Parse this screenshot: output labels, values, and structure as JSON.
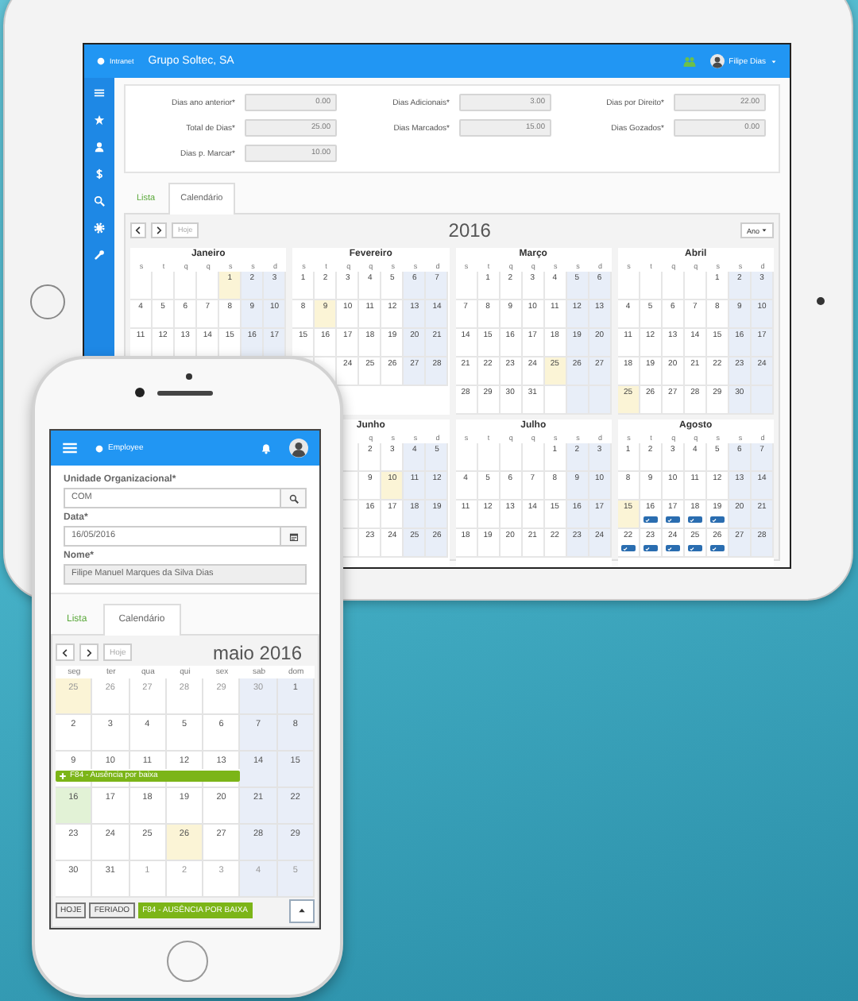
{
  "tablet": {
    "topbar": {
      "app": "Intranet",
      "company": "Grupo Soltec, SA",
      "user": "Filipe Dias"
    },
    "sidebar": {
      "items": [
        {
          "kind": "menu"
        },
        {
          "kind": "star"
        },
        {
          "kind": "user"
        },
        {
          "kind": "dollar"
        },
        {
          "kind": "search"
        },
        {
          "kind": "gear"
        },
        {
          "kind": "wrench"
        }
      ]
    },
    "fields": [
      {
        "label": "Dias ano anterior*",
        "value": "0.00",
        "disabled": true
      },
      {
        "label": "Dias Adicionais*",
        "value": "3.00",
        "disabled": true
      },
      {
        "label": "Dias por Direito*",
        "value": "22.00",
        "disabled": true
      },
      {
        "label": "Total de Dias*",
        "value": "25.00",
        "disabled": true
      },
      {
        "label": "Dias Marcados*",
        "value": "15.00",
        "disabled": true
      },
      {
        "label": "Dias Gozados*",
        "value": "0.00",
        "disabled": true
      },
      {
        "label": "Dias p. Marcar*",
        "value": "10.00",
        "disabled": true
      }
    ],
    "tabs": [
      {
        "label": "Lista",
        "selected": false
      },
      {
        "label": "Calendário",
        "selected": true
      }
    ],
    "calendar": {
      "today_button": {
        "label": "Hoje",
        "disabled": true
      },
      "title": "2016",
      "view_button": "Ano",
      "month_rows": [
        [
          {
            "name": "Janeiro",
            "weekdays": [
              "s",
              "t",
              "q",
              "q",
              "s",
              "s",
              "d"
            ],
            "weeks": [
              [
                {
                  "kind": "blank"
                },
                {
                  "kind": "blank"
                },
                {
                  "kind": "blank"
                },
                {
                  "kind": "blank"
                },
                {
                  "day": "1",
                  "kind": "holiday"
                },
                {
                  "day": "2",
                  "kind": "plain"
                },
                {
                  "day": "3",
                  "kind": "plain"
                }
              ],
              [
                {
                  "day": "4",
                  "kind": "plain"
                },
                {
                  "day": "5",
                  "kind": "plain"
                },
                {
                  "day": "6",
                  "kind": "plain"
                },
                {
                  "day": "7",
                  "kind": "plain"
                },
                {
                  "day": "8",
                  "kind": "plain"
                },
                {
                  "day": "9",
                  "kind": "plain"
                },
                {
                  "day": "10",
                  "kind": "plain"
                }
              ],
              [
                {
                  "day": "11",
                  "kind": "plain"
                },
                {
                  "day": "12",
                  "kind": "plain"
                },
                {
                  "day": "13",
                  "kind": "plain"
                },
                {
                  "day": "14",
                  "kind": "plain"
                },
                {
                  "day": "15",
                  "kind": "plain"
                },
                {
                  "day": "16",
                  "kind": "plain"
                },
                {
                  "day": "17",
                  "kind": "plain"
                }
              ]
            ]
          },
          {
            "name": "Fevereiro",
            "weekdays": [
              "s",
              "t",
              "q",
              "q",
              "s",
              "s",
              "d"
            ],
            "weeks": [
              [
                {
                  "day": "1",
                  "kind": "plain"
                },
                {
                  "day": "2",
                  "kind": "plain"
                },
                {
                  "day": "3",
                  "kind": "plain"
                },
                {
                  "day": "4",
                  "kind": "plain"
                },
                {
                  "day": "5",
                  "kind": "plain"
                },
                {
                  "day": "6",
                  "kind": "plain"
                },
                {
                  "day": "7",
                  "kind": "plain"
                }
              ],
              [
                {
                  "day": "8",
                  "kind": "plain"
                },
                {
                  "day": "9",
                  "kind": "holiday"
                },
                {
                  "day": "10",
                  "kind": "plain"
                },
                {
                  "day": "11",
                  "kind": "plain"
                },
                {
                  "day": "12",
                  "kind": "plain"
                },
                {
                  "day": "13",
                  "kind": "plain"
                },
                {
                  "day": "14",
                  "kind": "plain"
                }
              ],
              [
                {
                  "day": "15",
                  "kind": "plain"
                },
                {
                  "day": "16",
                  "kind": "plain"
                },
                {
                  "day": "17",
                  "kind": "plain"
                },
                {
                  "day": "18",
                  "kind": "plain"
                },
                {
                  "day": "19",
                  "kind": "plain"
                },
                {
                  "day": "20",
                  "kind": "plain"
                },
                {
                  "day": "21",
                  "kind": "plain"
                }
              ],
              [
                {
                  "day": "24",
                  "kind": "plain"
                },
                {
                  "day": "25",
                  "kind": "plain"
                },
                {
                  "day": "26",
                  "kind": "plain"
                },
                {
                  "day": "27",
                  "kind": "plain"
                },
                {
                  "day": "28",
                  "kind": "plain"
                }
              ]
            ]
          },
          {
            "name": "Março",
            "weekdays": [
              "s",
              "t",
              "q",
              "q",
              "s",
              "s",
              "d"
            ],
            "weeks": [
              [
                {
                  "kind": "blank"
                },
                {
                  "day": "1",
                  "kind": "plain"
                },
                {
                  "day": "2",
                  "kind": "plain"
                },
                {
                  "day": "3",
                  "kind": "plain"
                },
                {
                  "day": "4",
                  "kind": "plain"
                },
                {
                  "day": "5",
                  "kind": "plain"
                },
                {
                  "day": "6",
                  "kind": "plain"
                }
              ],
              [
                {
                  "day": "7",
                  "kind": "plain"
                },
                {
                  "day": "8",
                  "kind": "plain"
                },
                {
                  "day": "9",
                  "kind": "plain"
                },
                {
                  "day": "10",
                  "kind": "plain"
                },
                {
                  "day": "11",
                  "kind": "plain"
                },
                {
                  "day": "12",
                  "kind": "plain"
                },
                {
                  "day": "13",
                  "kind": "plain"
                }
              ],
              [
                {
                  "day": "14",
                  "kind": "plain"
                },
                {
                  "day": "15",
                  "kind": "plain"
                },
                {
                  "day": "16",
                  "kind": "plain"
                },
                {
                  "day": "17",
                  "kind": "plain"
                },
                {
                  "day": "18",
                  "kind": "plain"
                },
                {
                  "day": "19",
                  "kind": "plain"
                },
                {
                  "day": "20",
                  "kind": "plain"
                }
              ],
              [
                {
                  "day": "21",
                  "kind": "plain"
                },
                {
                  "day": "22",
                  "kind": "plain"
                },
                {
                  "day": "23",
                  "kind": "plain"
                },
                {
                  "day": "24",
                  "kind": "plain"
                },
                {
                  "day": "25",
                  "kind": "holiday"
                },
                {
                  "day": "26",
                  "kind": "plain"
                },
                {
                  "day": "27",
                  "kind": "plain"
                }
              ],
              [
                {
                  "day": "28",
                  "kind": "plain"
                },
                {
                  "day": "29",
                  "kind": "plain"
                },
                {
                  "day": "30",
                  "kind": "plain"
                },
                {
                  "day": "31",
                  "kind": "plain"
                },
                {
                  "kind": "blank"
                },
                {
                  "kind": "blank"
                },
                {
                  "kind": "blank"
                }
              ]
            ]
          },
          {
            "name": "Abril",
            "weekdays": [
              "s",
              "t",
              "q",
              "q",
              "s",
              "s",
              "d"
            ],
            "weeks": [
              [
                {
                  "kind": "blank"
                },
                {
                  "kind": "blank"
                },
                {
                  "kind": "blank"
                },
                {
                  "kind": "blank"
                },
                {
                  "day": "1",
                  "kind": "plain"
                },
                {
                  "day": "2",
                  "kind": "plain"
                },
                {
                  "day": "3",
                  "kind": "plain"
                }
              ],
              [
                {
                  "day": "4",
                  "kind": "plain"
                },
                {
                  "day": "5",
                  "kind": "plain"
                },
                {
                  "day": "6",
                  "kind": "plain"
                },
                {
                  "day": "7",
                  "kind": "plain"
                },
                {
                  "day": "8",
                  "kind": "plain"
                },
                {
                  "day": "9",
                  "kind": "plain"
                },
                {
                  "day": "10",
                  "kind": "plain"
                }
              ],
              [
                {
                  "day": "11",
                  "kind": "plain"
                },
                {
                  "day": "12",
                  "kind": "plain"
                },
                {
                  "day": "13",
                  "kind": "plain"
                },
                {
                  "day": "14",
                  "kind": "plain"
                },
                {
                  "day": "15",
                  "kind": "plain"
                },
                {
                  "day": "16",
                  "kind": "plain"
                },
                {
                  "day": "17",
                  "kind": "plain"
                }
              ],
              [
                {
                  "day": "18",
                  "kind": "plain"
                },
                {
                  "day": "19",
                  "kind": "plain"
                },
                {
                  "day": "20",
                  "kind": "plain"
                },
                {
                  "day": "21",
                  "kind": "plain"
                },
                {
                  "day": "22",
                  "kind": "plain"
                },
                {
                  "day": "23",
                  "kind": "plain"
                },
                {
                  "day": "24",
                  "kind": "plain"
                }
              ],
              [
                {
                  "day": "25",
                  "kind": "holiday"
                },
                {
                  "day": "26",
                  "kind": "plain"
                },
                {
                  "day": "27",
                  "kind": "plain"
                },
                {
                  "day": "28",
                  "kind": "plain"
                },
                {
                  "day": "29",
                  "kind": "plain"
                },
                {
                  "day": "30",
                  "kind": "plain"
                },
                {
                  "kind": "blank"
                }
              ]
            ]
          }
        ],
        [
          {
            "name": "Junho",
            "weekdays": [
              "q",
              "s",
              "s",
              "d"
            ],
            "weeks": [
              [
                {
                  "day": "2",
                  "kind": "plain"
                },
                {
                  "day": "3",
                  "kind": "plain"
                },
                {
                  "day": "4",
                  "kind": "plain"
                },
                {
                  "day": "5",
                  "kind": "plain"
                }
              ],
              [
                {
                  "day": "9",
                  "kind": "plain"
                },
                {
                  "day": "10",
                  "kind": "holiday"
                },
                {
                  "day": "11",
                  "kind": "plain"
                },
                {
                  "day": "12",
                  "kind": "plain"
                }
              ],
              [
                {
                  "day": "16",
                  "kind": "plain"
                },
                {
                  "day": "17",
                  "kind": "plain"
                },
                {
                  "day": "18",
                  "kind": "plain"
                },
                {
                  "day": "19",
                  "kind": "plain"
                }
              ],
              [
                {
                  "day": "23",
                  "kind": "plain"
                },
                {
                  "day": "24",
                  "kind": "plain"
                },
                {
                  "day": "25",
                  "kind": "plain"
                },
                {
                  "day": "26",
                  "kind": "plain"
                }
              ]
            ]
          },
          {
            "name": "Julho",
            "weekdays": [
              "s",
              "t",
              "q",
              "q",
              "s",
              "s",
              "d"
            ],
            "weeks": [
              [
                {
                  "kind": "blank"
                },
                {
                  "kind": "blank"
                },
                {
                  "kind": "blank"
                },
                {
                  "kind": "blank"
                },
                {
                  "day": "1",
                  "kind": "plain"
                },
                {
                  "day": "2",
                  "kind": "plain"
                },
                {
                  "day": "3",
                  "kind": "plain"
                }
              ],
              [
                {
                  "day": "4",
                  "kind": "plain"
                },
                {
                  "day": "5",
                  "kind": "plain"
                },
                {
                  "day": "6",
                  "kind": "plain"
                },
                {
                  "day": "7",
                  "kind": "plain"
                },
                {
                  "day": "8",
                  "kind": "plain"
                },
                {
                  "day": "9",
                  "kind": "plain"
                },
                {
                  "day": "10",
                  "kind": "plain"
                }
              ],
              [
                {
                  "day": "11",
                  "kind": "plain"
                },
                {
                  "day": "12",
                  "kind": "plain"
                },
                {
                  "day": "13",
                  "kind": "plain"
                },
                {
                  "day": "14",
                  "kind": "plain"
                },
                {
                  "day": "15",
                  "kind": "plain"
                },
                {
                  "day": "16",
                  "kind": "plain"
                },
                {
                  "day": "17",
                  "kind": "plain"
                }
              ],
              [
                {
                  "day": "18",
                  "kind": "plain"
                },
                {
                  "day": "19",
                  "kind": "plain"
                },
                {
                  "day": "20",
                  "kind": "plain"
                },
                {
                  "day": "21",
                  "kind": "plain"
                },
                {
                  "day": "22",
                  "kind": "plain"
                },
                {
                  "day": "23",
                  "kind": "plain"
                },
                {
                  "day": "24",
                  "kind": "plain"
                }
              ]
            ]
          },
          {
            "name": "Agosto",
            "weekdays": [
              "s",
              "t",
              "q",
              "q",
              "s",
              "s",
              "d"
            ],
            "weeks": [
              [
                {
                  "day": "1",
                  "kind": "plain"
                },
                {
                  "day": "2",
                  "kind": "plain"
                },
                {
                  "day": "3",
                  "kind": "plain"
                },
                {
                  "day": "4",
                  "kind": "plain"
                },
                {
                  "day": "5",
                  "kind": "plain"
                },
                {
                  "day": "6",
                  "kind": "plain"
                },
                {
                  "day": "7",
                  "kind": "plain"
                }
              ],
              [
                {
                  "day": "8",
                  "kind": "plain"
                },
                {
                  "day": "9",
                  "kind": "plain"
                },
                {
                  "day": "10",
                  "kind": "plain"
                },
                {
                  "day": "11",
                  "kind": "plain"
                },
                {
                  "day": "12",
                  "kind": "plain"
                },
                {
                  "day": "13",
                  "kind": "plain"
                },
                {
                  "day": "14",
                  "kind": "plain"
                }
              ],
              [
                {
                  "day": "15",
                  "kind": "holiday"
                },
                {
                  "day": "16",
                  "kind": "marked"
                },
                {
                  "day": "17",
                  "kind": "marked"
                },
                {
                  "day": "18",
                  "kind": "marked"
                },
                {
                  "day": "19",
                  "kind": "marked"
                },
                {
                  "day": "20",
                  "kind": "plain"
                },
                {
                  "day": "21",
                  "kind": "plain"
                }
              ],
              [
                {
                  "day": "22",
                  "kind": "marked"
                },
                {
                  "day": "23",
                  "kind": "marked"
                },
                {
                  "day": "24",
                  "kind": "marked"
                },
                {
                  "day": "25",
                  "kind": "marked"
                },
                {
                  "day": "26",
                  "kind": "marked"
                },
                {
                  "day": "27",
                  "kind": "plain"
                },
                {
                  "day": "28",
                  "kind": "plain"
                }
              ]
            ]
          }
        ]
      ]
    }
  },
  "phone": {
    "topbar": {
      "app": "Employee"
    },
    "fields": [
      {
        "label": "Unidade Organizacional*",
        "value": "COM",
        "disabled": false,
        "kind": "search"
      },
      {
        "label": "Data*",
        "value": "16/05/2016",
        "disabled": false,
        "kind": "calendar"
      },
      {
        "label": "Nome*",
        "value": "Filipe Manuel Marques da Silva Dias",
        "disabled": true,
        "kind": "plain"
      }
    ],
    "tabs": [
      {
        "label": "Lista",
        "selected": false
      },
      {
        "label": "Calendário",
        "selected": true
      }
    ],
    "calendar": {
      "today_button": {
        "label": "Hoje",
        "disabled": true
      },
      "title": "maio 2016",
      "weekdays": [
        "seg",
        "ter",
        "qua",
        "qui",
        "sex",
        "sab",
        "dom"
      ],
      "weeks": [
        {
          "days": [
            {
              "day": "25",
              "outside": true,
              "kind": "holiday"
            },
            {
              "day": "26",
              "outside": true,
              "kind": "plain"
            },
            {
              "day": "27",
              "outside": true,
              "kind": "plain"
            },
            {
              "day": "28",
              "outside": true,
              "kind": "plain"
            },
            {
              "day": "29",
              "outside": true,
              "kind": "plain"
            },
            {
              "day": "30",
              "outside": true,
              "kind": "plain"
            },
            {
              "day": "1",
              "outside": false,
              "kind": "plain"
            }
          ]
        },
        {
          "days": [
            {
              "day": "2",
              "outside": false,
              "kind": "plain"
            },
            {
              "day": "3",
              "outside": false,
              "kind": "plain"
            },
            {
              "day": "4",
              "outside": false,
              "kind": "plain"
            },
            {
              "day": "5",
              "outside": false,
              "kind": "plain"
            },
            {
              "day": "6",
              "outside": false,
              "kind": "plain"
            },
            {
              "day": "7",
              "outside": false,
              "kind": "plain"
            },
            {
              "day": "8",
              "outside": false,
              "kind": "plain"
            }
          ]
        },
        {
          "days": [
            {
              "day": "9",
              "outside": false,
              "kind": "plain"
            },
            {
              "day": "10",
              "outside": false,
              "kind": "plain"
            },
            {
              "day": "11",
              "outside": false,
              "kind": "plain"
            },
            {
              "day": "12",
              "outside": false,
              "kind": "plain"
            },
            {
              "day": "13",
              "outside": false,
              "kind": "plain"
            },
            {
              "day": "14",
              "outside": false,
              "kind": "plain"
            },
            {
              "day": "15",
              "outside": false,
              "kind": "plain"
            }
          ],
          "event": {
            "label": "F84 - Ausência por baixa"
          }
        },
        {
          "days": [
            {
              "day": "16",
              "outside": false,
              "kind": "today"
            },
            {
              "day": "17",
              "outside": false,
              "kind": "plain"
            },
            {
              "day": "18",
              "outside": false,
              "kind": "plain"
            },
            {
              "day": "19",
              "outside": false,
              "kind": "plain"
            },
            {
              "day": "20",
              "outside": false,
              "kind": "plain"
            },
            {
              "day": "21",
              "outside": false,
              "kind": "plain"
            },
            {
              "day": "22",
              "outside": false,
              "kind": "plain"
            }
          ]
        },
        {
          "days": [
            {
              "day": "23",
              "outside": false,
              "kind": "plain"
            },
            {
              "day": "24",
              "outside": false,
              "kind": "plain"
            },
            {
              "day": "25",
              "outside": false,
              "kind": "plain"
            },
            {
              "day": "26",
              "outside": false,
              "kind": "holiday"
            },
            {
              "day": "27",
              "outside": false,
              "kind": "plain"
            },
            {
              "day": "28",
              "outside": false,
              "kind": "plain"
            },
            {
              "day": "29",
              "outside": false,
              "kind": "plain"
            }
          ]
        },
        {
          "days": [
            {
              "day": "30",
              "outside": false,
              "kind": "plain"
            },
            {
              "day": "31",
              "outside": false,
              "kind": "plain"
            },
            {
              "day": "1",
              "outside": true,
              "kind": "plain"
            },
            {
              "day": "2",
              "outside": true,
              "kind": "plain"
            },
            {
              "day": "3",
              "outside": true,
              "kind": "plain"
            },
            {
              "day": "4",
              "outside": true,
              "kind": "plain"
            },
            {
              "day": "5",
              "outside": true,
              "kind": "plain"
            }
          ]
        }
      ],
      "legend": [
        {
          "label": "HOJE",
          "kind": "outline"
        },
        {
          "label": "FERIADO",
          "kind": "outline"
        },
        {
          "label": "F84 - AUSÊNCIA POR BAIXA",
          "kind": "filled"
        }
      ]
    }
  }
}
